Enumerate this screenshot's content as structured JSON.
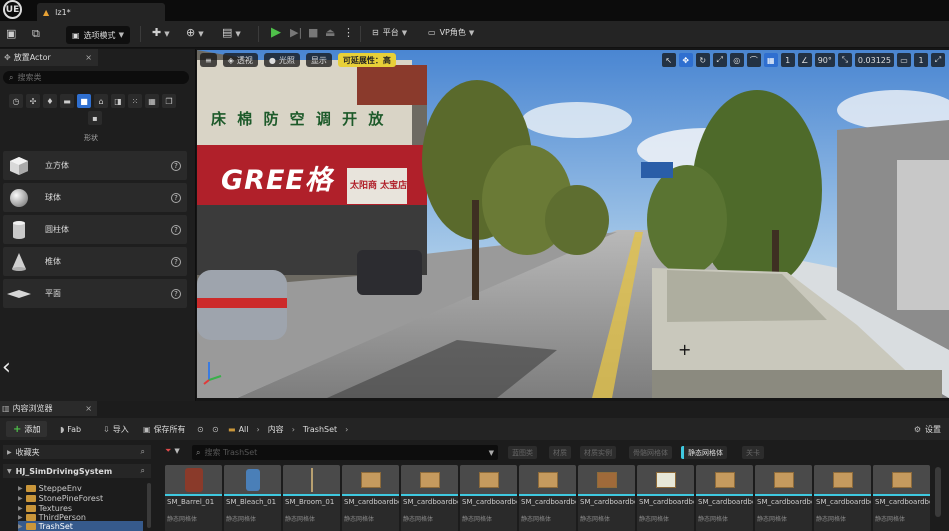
{
  "titlebar": {
    "logo": "UE",
    "level_tab": "lz1*"
  },
  "toolbar": {
    "select_mode": "选项模式",
    "platform": "平台",
    "vp_role": "VP角色"
  },
  "place_actor": {
    "tab_label": "放置Actor",
    "search_placeholder": "搜索类",
    "category_label": "形状",
    "shapes": [
      {
        "label": "立方体",
        "icon": "cube-icon"
      },
      {
        "label": "球体",
        "icon": "sphere-icon"
      },
      {
        "label": "圆柱体",
        "icon": "cylinder-icon"
      },
      {
        "label": "椎体",
        "icon": "cone-icon"
      },
      {
        "label": "平面",
        "icon": "plane-icon"
      }
    ]
  },
  "viewport": {
    "view_mode": "透视",
    "lighting": "光照",
    "show": "显示",
    "scalability": "可延展性：高",
    "snap_grid": "1",
    "snap_rotation": "90°",
    "snap_scale": "0.03125",
    "camera_speed": "1",
    "scene": {
      "sign_top": "床 棉 防 空 调 开 放",
      "sign_brand": "GREE格",
      "sign_shop": "太阳商 太宝店"
    }
  },
  "content_browser": {
    "tab_label": "内容浏览器",
    "add": "添加",
    "fab": "Fab",
    "import": "导入",
    "save_all": "保存所有",
    "breadcrumb": [
      "All",
      "内容",
      "TrashSet"
    ],
    "settings": "设置",
    "favorites": "收藏夹",
    "project": "HJ_SimDrivingSystem",
    "folders": [
      "SteppeEnv",
      "StonePineForest",
      "Textures",
      "ThirdPerson",
      "TrashSet"
    ],
    "search_placeholder": "搜索 TrashSet",
    "filters": [
      {
        "label": "蓝图类",
        "active": false
      },
      {
        "label": "材质",
        "active": false
      },
      {
        "label": "材质实例",
        "active": false
      },
      {
        "label": "骨骼网格体",
        "active": false
      },
      {
        "label": "静态网格体",
        "active": true
      },
      {
        "label": "关卡",
        "active": false
      }
    ],
    "assets": [
      {
        "name": "SM_Barrel_01",
        "type": "静态网格体",
        "thumb": "barrel"
      },
      {
        "name": "SM_Bleach_01",
        "type": "静态网格体",
        "thumb": "bottle"
      },
      {
        "name": "SM_Broom_01",
        "type": "静态网格体",
        "thumb": "broom"
      },
      {
        "name": "SM_cardboardbox_",
        "type": "静态网格体",
        "thumb": "box"
      },
      {
        "name": "SM_cardboardbox_",
        "type": "静态网格体",
        "thumb": "box"
      },
      {
        "name": "SM_cardboardbox_",
        "type": "静态网格体",
        "thumb": "box"
      },
      {
        "name": "SM_cardboardbox_",
        "type": "静态网格体",
        "thumb": "box"
      },
      {
        "name": "SM_cardboardbox_",
        "type": "静态网格体",
        "thumb": "box"
      },
      {
        "name": "SM_cardboardbox_",
        "type": "静态网格体",
        "thumb": "boxc"
      },
      {
        "name": "SM_cardboardbox_",
        "type": "静态网格体",
        "thumb": "box"
      },
      {
        "name": "SM_cardboardbox_",
        "type": "静态网格体",
        "thumb": "box"
      },
      {
        "name": "SM_cardboardbox_",
        "type": "静态网格体",
        "thumb": "box"
      },
      {
        "name": "SM_cardboardbox_",
        "type": "静态网格体",
        "thumb": "box"
      }
    ]
  }
}
